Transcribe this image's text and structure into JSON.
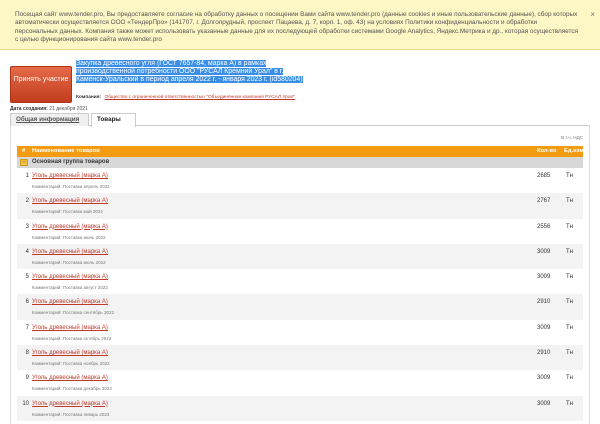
{
  "cookie": {
    "text": "Посещая сайт www.tender.pro, Вы предоставляете согласие на обработку данных о посещении Вами сайта www.tender.pro (данные cookies и иные пользовательские данные), сбор которых автоматически осуществляется ООО «ТендерПро» (141707, г. Долгопрудный, проспект Пацаева, д. 7, корп. 1, оф. 43) на условиях Политики конфиденциальности и обработки персональных данных. Компания также может использовать указанные данные для их последующей обработки системами Google Analytics, Яндекс.Метрика и др., которая осуществляется с целью функционирования сайта www.tender.pro",
    "close": "×"
  },
  "header": {
    "apply_button": "Принять участие",
    "title": "Закупка древесного угля (ГОСТ 7657-84, марка А) в рамках производственной потребности ООО \"РУСАЛ Кремний Урал\" в г. Каменск-Уральский в период апреля 2022 г. - января 2023 г. (id580204)",
    "company_label": "Компания:",
    "company_name": "Общество с ограниченной ответственностью \"Объединённая компания РУСАЛ Урал\"",
    "date_label": "Дата создания:",
    "date_value": "21 декабря 2021"
  },
  "tabs": [
    {
      "label": "Общая информация"
    },
    {
      "label": "Товары"
    }
  ],
  "vat_note": "В т.ч. НДС",
  "table": {
    "columns": {
      "num": "#",
      "name": "Наименование товаров",
      "qty": "Кол-во",
      "unit": "Ед.изм."
    },
    "group_name": "Основная группа товаров",
    "rows": [
      {
        "num": "1",
        "name": "Уголь древесный (марка А)",
        "comment": "Комментарий: Поставка апрель 2022",
        "qty": "2685",
        "unit": "Тн"
      },
      {
        "num": "2",
        "name": "Уголь древесный (марка А)",
        "comment": "Комментарий: Поставка май 2022",
        "qty": "2767",
        "unit": "Тн"
      },
      {
        "num": "3",
        "name": "Уголь древесный (марка А)",
        "comment": "Комментарий: Поставка июнь 2022",
        "qty": "2556",
        "unit": "Тн"
      },
      {
        "num": "4",
        "name": "Уголь древесный (марка А)",
        "comment": "Комментарий: Поставка июль 2022",
        "qty": "3009",
        "unit": "Тн"
      },
      {
        "num": "5",
        "name": "Уголь древесный (марка А)",
        "comment": "Комментарий: Поставка август 2022",
        "qty": "3009",
        "unit": "Тн"
      },
      {
        "num": "6",
        "name": "Уголь древесный (марка А)",
        "comment": "Комментарий: Поставка сентябрь 2022",
        "qty": "2910",
        "unit": "Тн"
      },
      {
        "num": "7",
        "name": "Уголь древесный (марка А)",
        "comment": "Комментарий: Поставка октябрь 2022",
        "qty": "3009",
        "unit": "Тн"
      },
      {
        "num": "8",
        "name": "Уголь древесный (марка А)",
        "comment": "Комментарий: Поставка ноябрь 2022",
        "qty": "2910",
        "unit": "Тн"
      },
      {
        "num": "9",
        "name": "Уголь древесный (марка А)",
        "comment": "Комментарий: Поставка декабрь 2022",
        "qty": "3009",
        "unit": "Тн"
      },
      {
        "num": "10",
        "name": "Уголь древесный (марка А)",
        "comment": "Комментарий: Поставка январь 2023",
        "qty": "3009",
        "unit": "Тн"
      }
    ]
  }
}
